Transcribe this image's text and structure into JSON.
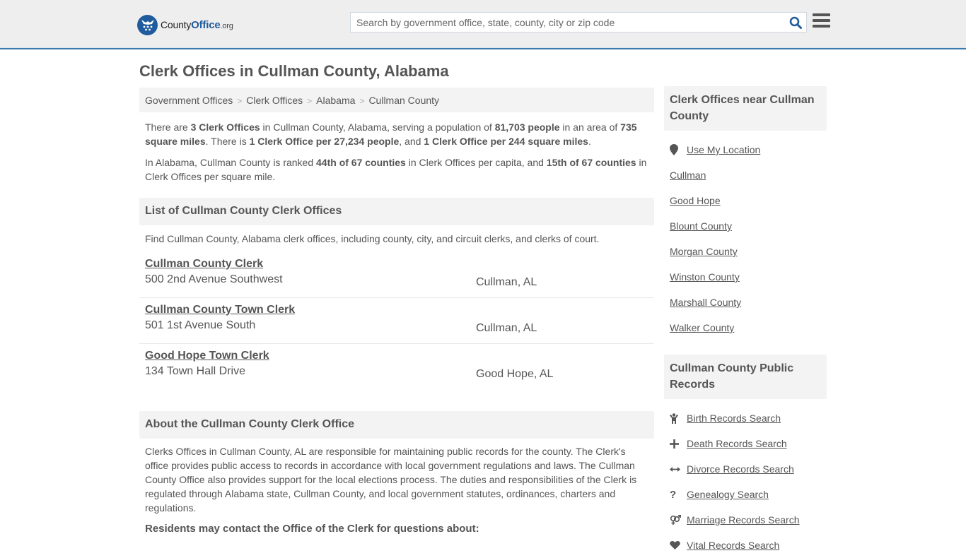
{
  "header": {
    "logo": {
      "name_part1": "County",
      "name_part2": "Office",
      "name_part3": ".org"
    },
    "search": {
      "placeholder": "Search by government office, state, county, city or zip code",
      "value": ""
    },
    "brand_color": "#1f5b9d",
    "accent_border_color": "#3a7aad"
  },
  "page": {
    "title": "Clerk Offices in Cullman County, Alabama"
  },
  "breadcrumb": [
    {
      "label": "Government Offices"
    },
    {
      "label": "Clerk Offices"
    },
    {
      "label": "Alabama"
    },
    {
      "label": "Cullman County"
    }
  ],
  "summary": {
    "p1": {
      "t1": "There are ",
      "b1": "3 Clerk Offices",
      "t2": " in Cullman County, Alabama, serving a population of ",
      "b2": "81,703 people",
      "t3": " in an area of ",
      "b3": "735 square miles",
      "t4": ". There is ",
      "b4": "1 Clerk Office per 27,234 people",
      "t5": ", and ",
      "b5": "1 Clerk Office per 244 square miles",
      "t6": "."
    },
    "p2": {
      "t1": "In Alabama, Cullman County is ranked ",
      "b1": "44th of 67 counties",
      "t2": " in Clerk Offices per capita, and ",
      "b2": "15th of 67 counties",
      "t3": " in Clerk Offices per square mile."
    }
  },
  "list_section": {
    "heading": "List of Cullman County Clerk Offices",
    "intro": "Find Cullman County, Alabama clerk offices, including county, city, and circuit clerks, and clerks of court.",
    "offices": [
      {
        "name": "Cullman County Clerk",
        "address": "500 2nd Avenue Southwest",
        "city": "Cullman, AL"
      },
      {
        "name": "Cullman County Town Clerk",
        "address": "501 1st Avenue South",
        "city": "Cullman, AL"
      },
      {
        "name": "Good Hope Town Clerk",
        "address": "134 Town Hall Drive",
        "city": "Good Hope, AL"
      }
    ]
  },
  "about_section": {
    "heading": "About the Cullman County Clerk Office",
    "body": "Clerks Offices in Cullman County, AL are responsible for maintaining public records for the county. The Clerk's office provides public access to records in accordance with local government regulations and laws. The Cullman County Office also provides support for the local elections process. The duties and responsibilities of the Clerk is regulated through Alabama state, Cullman County, and local government statutes, ordinances, charters and regulations.",
    "contact_heading": "Residents may contact the Office of the Clerk for questions about:"
  },
  "sidebar": {
    "nearby": {
      "heading": "Clerk Offices near Cullman County",
      "use_location": {
        "icon": "map-pin-icon",
        "label": "Use My Location"
      },
      "links": [
        {
          "label": "Cullman"
        },
        {
          "label": "Good Hope"
        },
        {
          "label": "Blount County"
        },
        {
          "label": "Morgan County"
        },
        {
          "label": "Winston County"
        },
        {
          "label": "Marshall County"
        },
        {
          "label": "Walker County"
        }
      ]
    },
    "public_records": {
      "heading": "Cullman County Public Records",
      "links": [
        {
          "icon": "child-icon",
          "label": "Birth Records Search"
        },
        {
          "icon": "plus-icon",
          "label": "Death Records Search"
        },
        {
          "icon": "arrows-horizontal-icon",
          "label": "Divorce Records Search"
        },
        {
          "icon": "question-icon",
          "label": "Genealogy Search"
        },
        {
          "icon": "venus-mars-icon",
          "label": "Marriage Records Search"
        },
        {
          "icon": "heartbeat-icon",
          "label": "Vital Records Search"
        }
      ]
    }
  }
}
